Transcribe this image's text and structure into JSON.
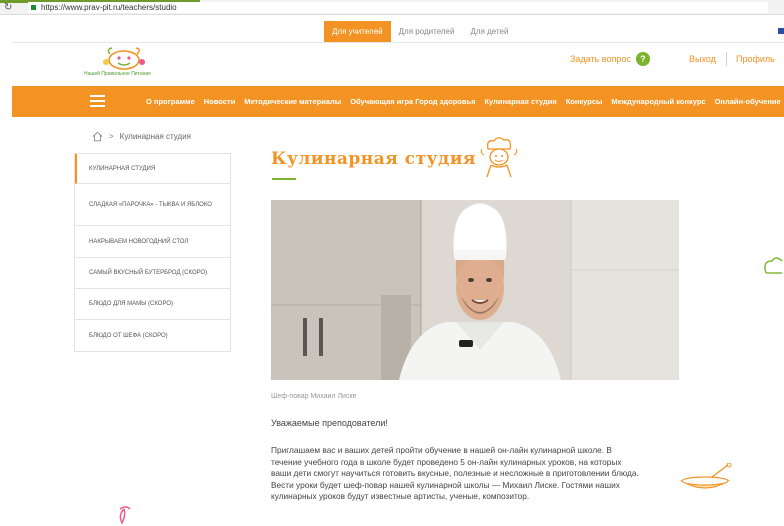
{
  "browser": {
    "url": "https://www.prav-pit.ru/teachers/studio"
  },
  "audience_tabs": [
    {
      "label": "Для учителей",
      "active": true
    },
    {
      "label": "Для родителей",
      "active": false
    },
    {
      "label": "Для детей",
      "active": false
    }
  ],
  "header": {
    "logo_text": "Нашей Правильное Питание",
    "ask_label": "Задать вопрос",
    "ask_icon": "question-icon",
    "exit_label": "Выход",
    "profile_label": "Профиль"
  },
  "nav": {
    "items": [
      "О программе",
      "Новости",
      "Методические материалы",
      "Обучающая игра Город здоровья",
      "Кулинарная студия",
      "Конкурсы",
      "Международный конкурс",
      "Онлайн-обучение"
    ]
  },
  "breadcrumb": {
    "separator": ">",
    "current": "Кулинарная студия"
  },
  "sidebar": {
    "items": [
      {
        "label": "Кулинарная студия",
        "active": true
      },
      {
        "label": "Сладкая «парочка» - тыква и яблоко",
        "active": false
      },
      {
        "label": "Накрываем новогодний стол",
        "active": false
      },
      {
        "label": "Самый вкусный бутерброд (скоро)",
        "active": false
      },
      {
        "label": "Блюдо для мамы (скоро)",
        "active": false
      },
      {
        "label": "Блюдо от шефа (скоро)",
        "active": false
      }
    ]
  },
  "content": {
    "title": "Кулинарная студия",
    "photo_caption": "Шеф-повар Михаил Лиске",
    "greeting": "Уважаемые преподователи!",
    "body": "Приглашаем вас и ваших детей пройти обучение в нашей он-лайн кулинарной школе. В течение учебного года в школе будет проведено 5 он-лайн кулинарных уроков, на которых ваши дети смогут научиться готовить вкусные, полезные и несложные в приготовлении блюда. Вести уроки будет шеф-повар нашей кулинарной школы — Михаил Лиске. Гостями наших кулинарных уроков будут известные артисты, ученые, композитор."
  },
  "colors": {
    "accent": "#f39324",
    "green": "#7ab32e"
  }
}
